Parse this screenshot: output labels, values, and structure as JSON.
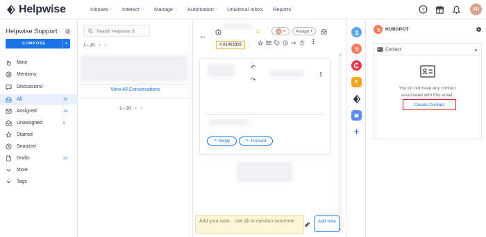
{
  "app": {
    "logo_text": "Helpwise",
    "brand_color": "#2b3445",
    "accent_color": "#1a73e8"
  },
  "topnav": {
    "items": [
      {
        "label": "Inboxes",
        "has_dropdown": true
      },
      {
        "label": "Interact",
        "has_dropdown": true
      },
      {
        "label": "Manage",
        "has_dropdown": true
      },
      {
        "label": "Automation",
        "has_dropdown": true
      },
      {
        "label": "Universal Inbox",
        "has_dropdown": false
      },
      {
        "label": "Reports",
        "has_dropdown": false
      }
    ],
    "icons": [
      "help-icon",
      "gift-icon",
      "bell-icon"
    ],
    "avatar_initials": "AD"
  },
  "sidebar": {
    "workspace_title": "Helpwise Support",
    "compose_label": "COMPOSE",
    "items": [
      {
        "label": "Mine",
        "icon": "hand-icon",
        "count": ""
      },
      {
        "label": "Mentions",
        "icon": "at-icon",
        "count": ""
      },
      {
        "label": "Discussions",
        "icon": "chat-icon",
        "count": ""
      },
      {
        "label": "All",
        "icon": "inbox-icon",
        "count": "19",
        "active": true
      },
      {
        "label": "Assigned",
        "icon": "mail-icon",
        "count": "14"
      },
      {
        "label": "Unassigned",
        "icon": "open-mail-icon",
        "count": "5"
      },
      {
        "label": "Starred",
        "icon": "star-icon",
        "count": ""
      },
      {
        "label": "Snoozed",
        "icon": "clock-icon",
        "count": ""
      },
      {
        "label": "Drafts",
        "icon": "file-icon",
        "count": "22"
      },
      {
        "label": "More",
        "icon": "chevron-down-icon",
        "count": ""
      },
      {
        "label": "Tags",
        "icon": "chevron-down-icon",
        "count": ""
      }
    ]
  },
  "conversation_list": {
    "search_placeholder": "Search Helpwise S",
    "pager_top": "1 - 20",
    "view_all_label": "View All Conversations",
    "pager_bottom": "1 - 20"
  },
  "thread": {
    "ticket_id": "# 81463308",
    "assign_label": "Assign",
    "assignee_initials": "AD",
    "reply_label": "Reply",
    "forward_label": "Forward",
    "note_placeholder": "Add your note... use @ to mention someone",
    "add_note_label": "Add note"
  },
  "app_strip": {
    "icons": [
      "contact-app-icon",
      "hubspot-app-icon",
      "crm-app-icon",
      "coin-app-icon",
      "helpwise-app-icon",
      "calendar-app-icon",
      "add-app-icon"
    ]
  },
  "hubspot": {
    "title": "HUBSPOT",
    "section_label": "Contact",
    "no_contact_line1": "You do not have any contact",
    "no_contact_line2": "associated with this email.",
    "create_contact_label": "Create Contact",
    "brand_color": "#ff7a59",
    "highlight_color": "#e0201e"
  }
}
